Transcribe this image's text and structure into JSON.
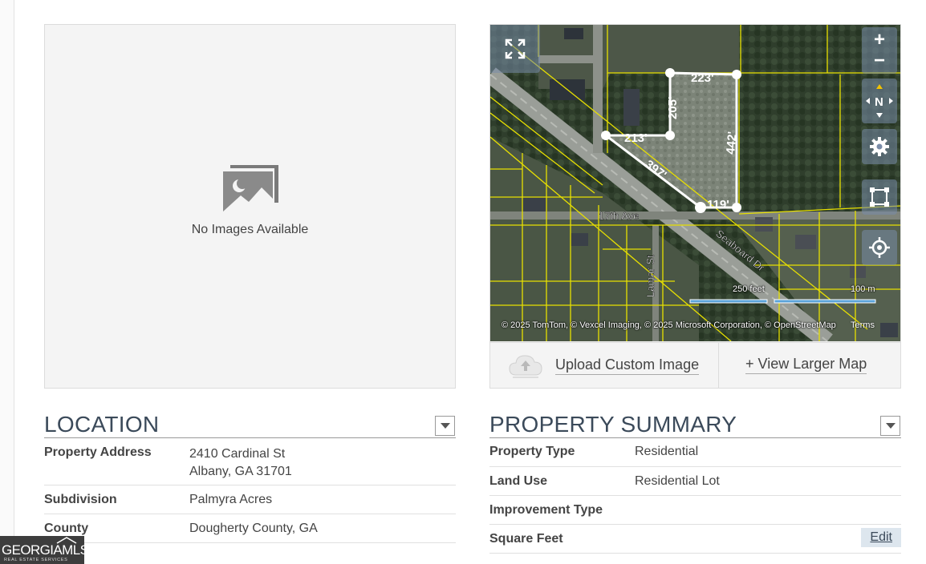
{
  "image_panel": {
    "placeholder_text": "No Images Available"
  },
  "map": {
    "copyright": "© 2025 TomTom, © Vexcel Imaging, © 2025 Microsoft Corporation, © OpenStreetMap",
    "terms": "Terms",
    "scale_feet": "250 feet",
    "scale_meters": "100 m",
    "street_labels": {
      "seventeenth": "17th Ave",
      "seaboard": "Seaboard Dr",
      "lamar": "Lamar St"
    },
    "measurements": {
      "top": "223'",
      "left_vertical": "205'",
      "middle": "213'",
      "diagonal": "397'",
      "right_vertical": "442'",
      "bottom": "119'"
    },
    "controls": {
      "zoom_in": "+",
      "zoom_out": "−",
      "compass": "N"
    },
    "upload_label": "Upload Custom Image",
    "view_larger_label": "+ View Larger Map"
  },
  "location": {
    "title": "LOCATION",
    "rows": [
      {
        "label": "Property Address",
        "value_line1": "2410 Cardinal St",
        "value_line2": "Albany, GA 31701"
      },
      {
        "label": "Subdivision",
        "value": "Palmyra Acres"
      },
      {
        "label": "County",
        "value": "Dougherty County, GA"
      }
    ]
  },
  "property_summary": {
    "title": "PROPERTY SUMMARY",
    "rows": [
      {
        "label": "Property Type",
        "value": "Residential"
      },
      {
        "label": "Land Use",
        "value": "Residential Lot"
      },
      {
        "label": "Improvement Type",
        "value": ""
      },
      {
        "label": "Square Feet",
        "value": ""
      }
    ],
    "edit_label": "Edit"
  },
  "logo": {
    "main": "GEORGIAMLS",
    "sub": "REAL ESTATE SERVICES"
  },
  "colors": {
    "title": "#3b4a5a",
    "parcel_lines": "#e8e000",
    "edit_bg": "#dde6ee"
  }
}
